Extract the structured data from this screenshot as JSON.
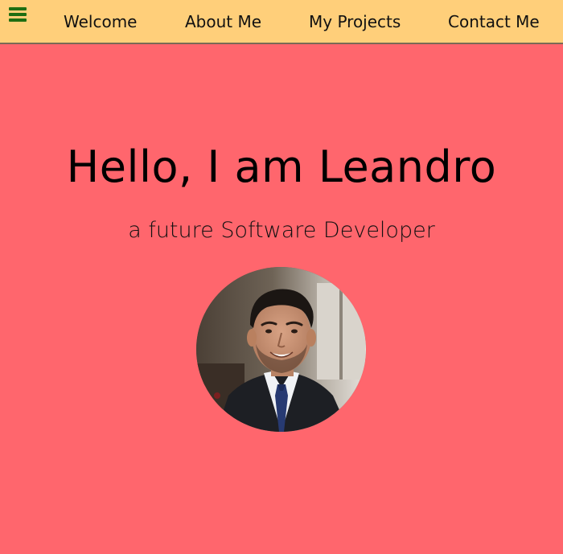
{
  "nav": {
    "menu_icon": "hamburger-menu-icon",
    "menu_icon_color": "#1f6e12",
    "background": "#ffcf7a",
    "links": [
      {
        "label": "Welcome"
      },
      {
        "label": "About Me"
      },
      {
        "label": "My Projects"
      },
      {
        "label": "Contact Me"
      }
    ]
  },
  "hero": {
    "title": "Hello, I am Leandro",
    "subtitle": "a future Software Developer",
    "background": "#ff666d",
    "avatar_alt": "profile-photo"
  }
}
